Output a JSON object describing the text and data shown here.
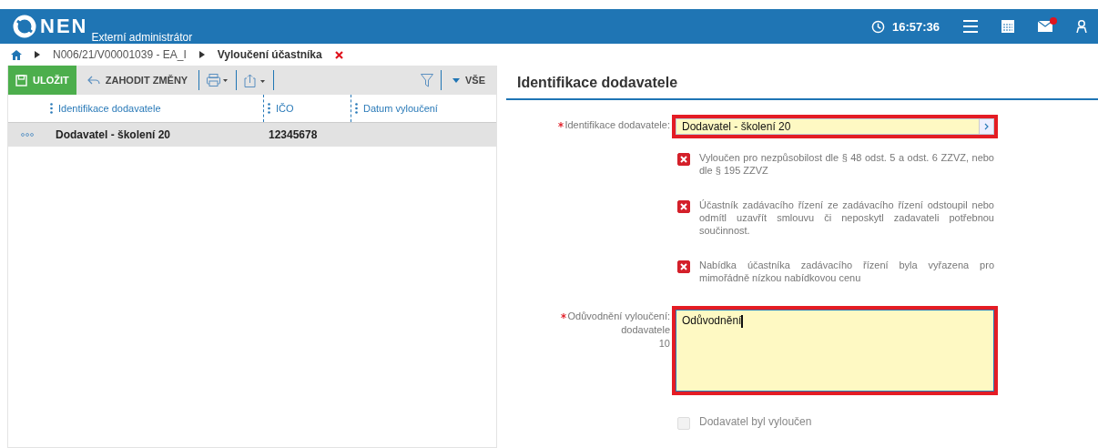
{
  "header": {
    "logo": "NEN",
    "subtitle": "Externí administrátor",
    "time": "16:57:36",
    "mail_unread": true
  },
  "breadcrumb": [
    {
      "label": "N006/21/V00001039 - EA_I",
      "current": false
    },
    {
      "label": "Vyloučení účastníka",
      "current": true
    }
  ],
  "toolbar": {
    "save": "ULOŽIT",
    "discard": "ZAHODIT ZMĚNY",
    "filter_scope": "VŠE"
  },
  "table": {
    "columns": [
      "Identifikace dodavatele",
      "IČO",
      "Datum vyloučení"
    ],
    "rows": [
      {
        "cells": [
          "Dodavatel - školení 20",
          "12345678",
          ""
        ],
        "selected": true
      }
    ]
  },
  "form": {
    "title": "Identifikace dodavatele",
    "supplier": {
      "label": "Identifikace dodavatele:",
      "required": true,
      "value": "Dodavatel - školení 20",
      "highlighted": true
    },
    "reasons": [
      {
        "text": "Vyloučen pro nezpůsobilost dle § 48 odst. 5 a odst. 6 ZZVZ, nebo dle § 195 ZZVZ",
        "checked": true
      },
      {
        "text": "Účastník zadávacího řízení ze zadávacího řízení odstoupil nebo odmítl uzavřít smlouvu či neposkytl zadavateli potřebnou součinnost.",
        "checked": true
      },
      {
        "text": "Nabídka účastníka zadávacího řízení byla vyřazena pro mimořádně nízkou nabídkovou cenu",
        "checked": true
      }
    ],
    "justification": {
      "label_lines": [
        "Odůvodnění vyloučení:",
        "dodavatele"
      ],
      "counter": "10",
      "required": true,
      "value": "Odůvodnění",
      "highlighted": true,
      "focused": true
    },
    "excluded": {
      "label": "Dodavatel byl vyloučen",
      "checked": false,
      "disabled": true
    }
  }
}
